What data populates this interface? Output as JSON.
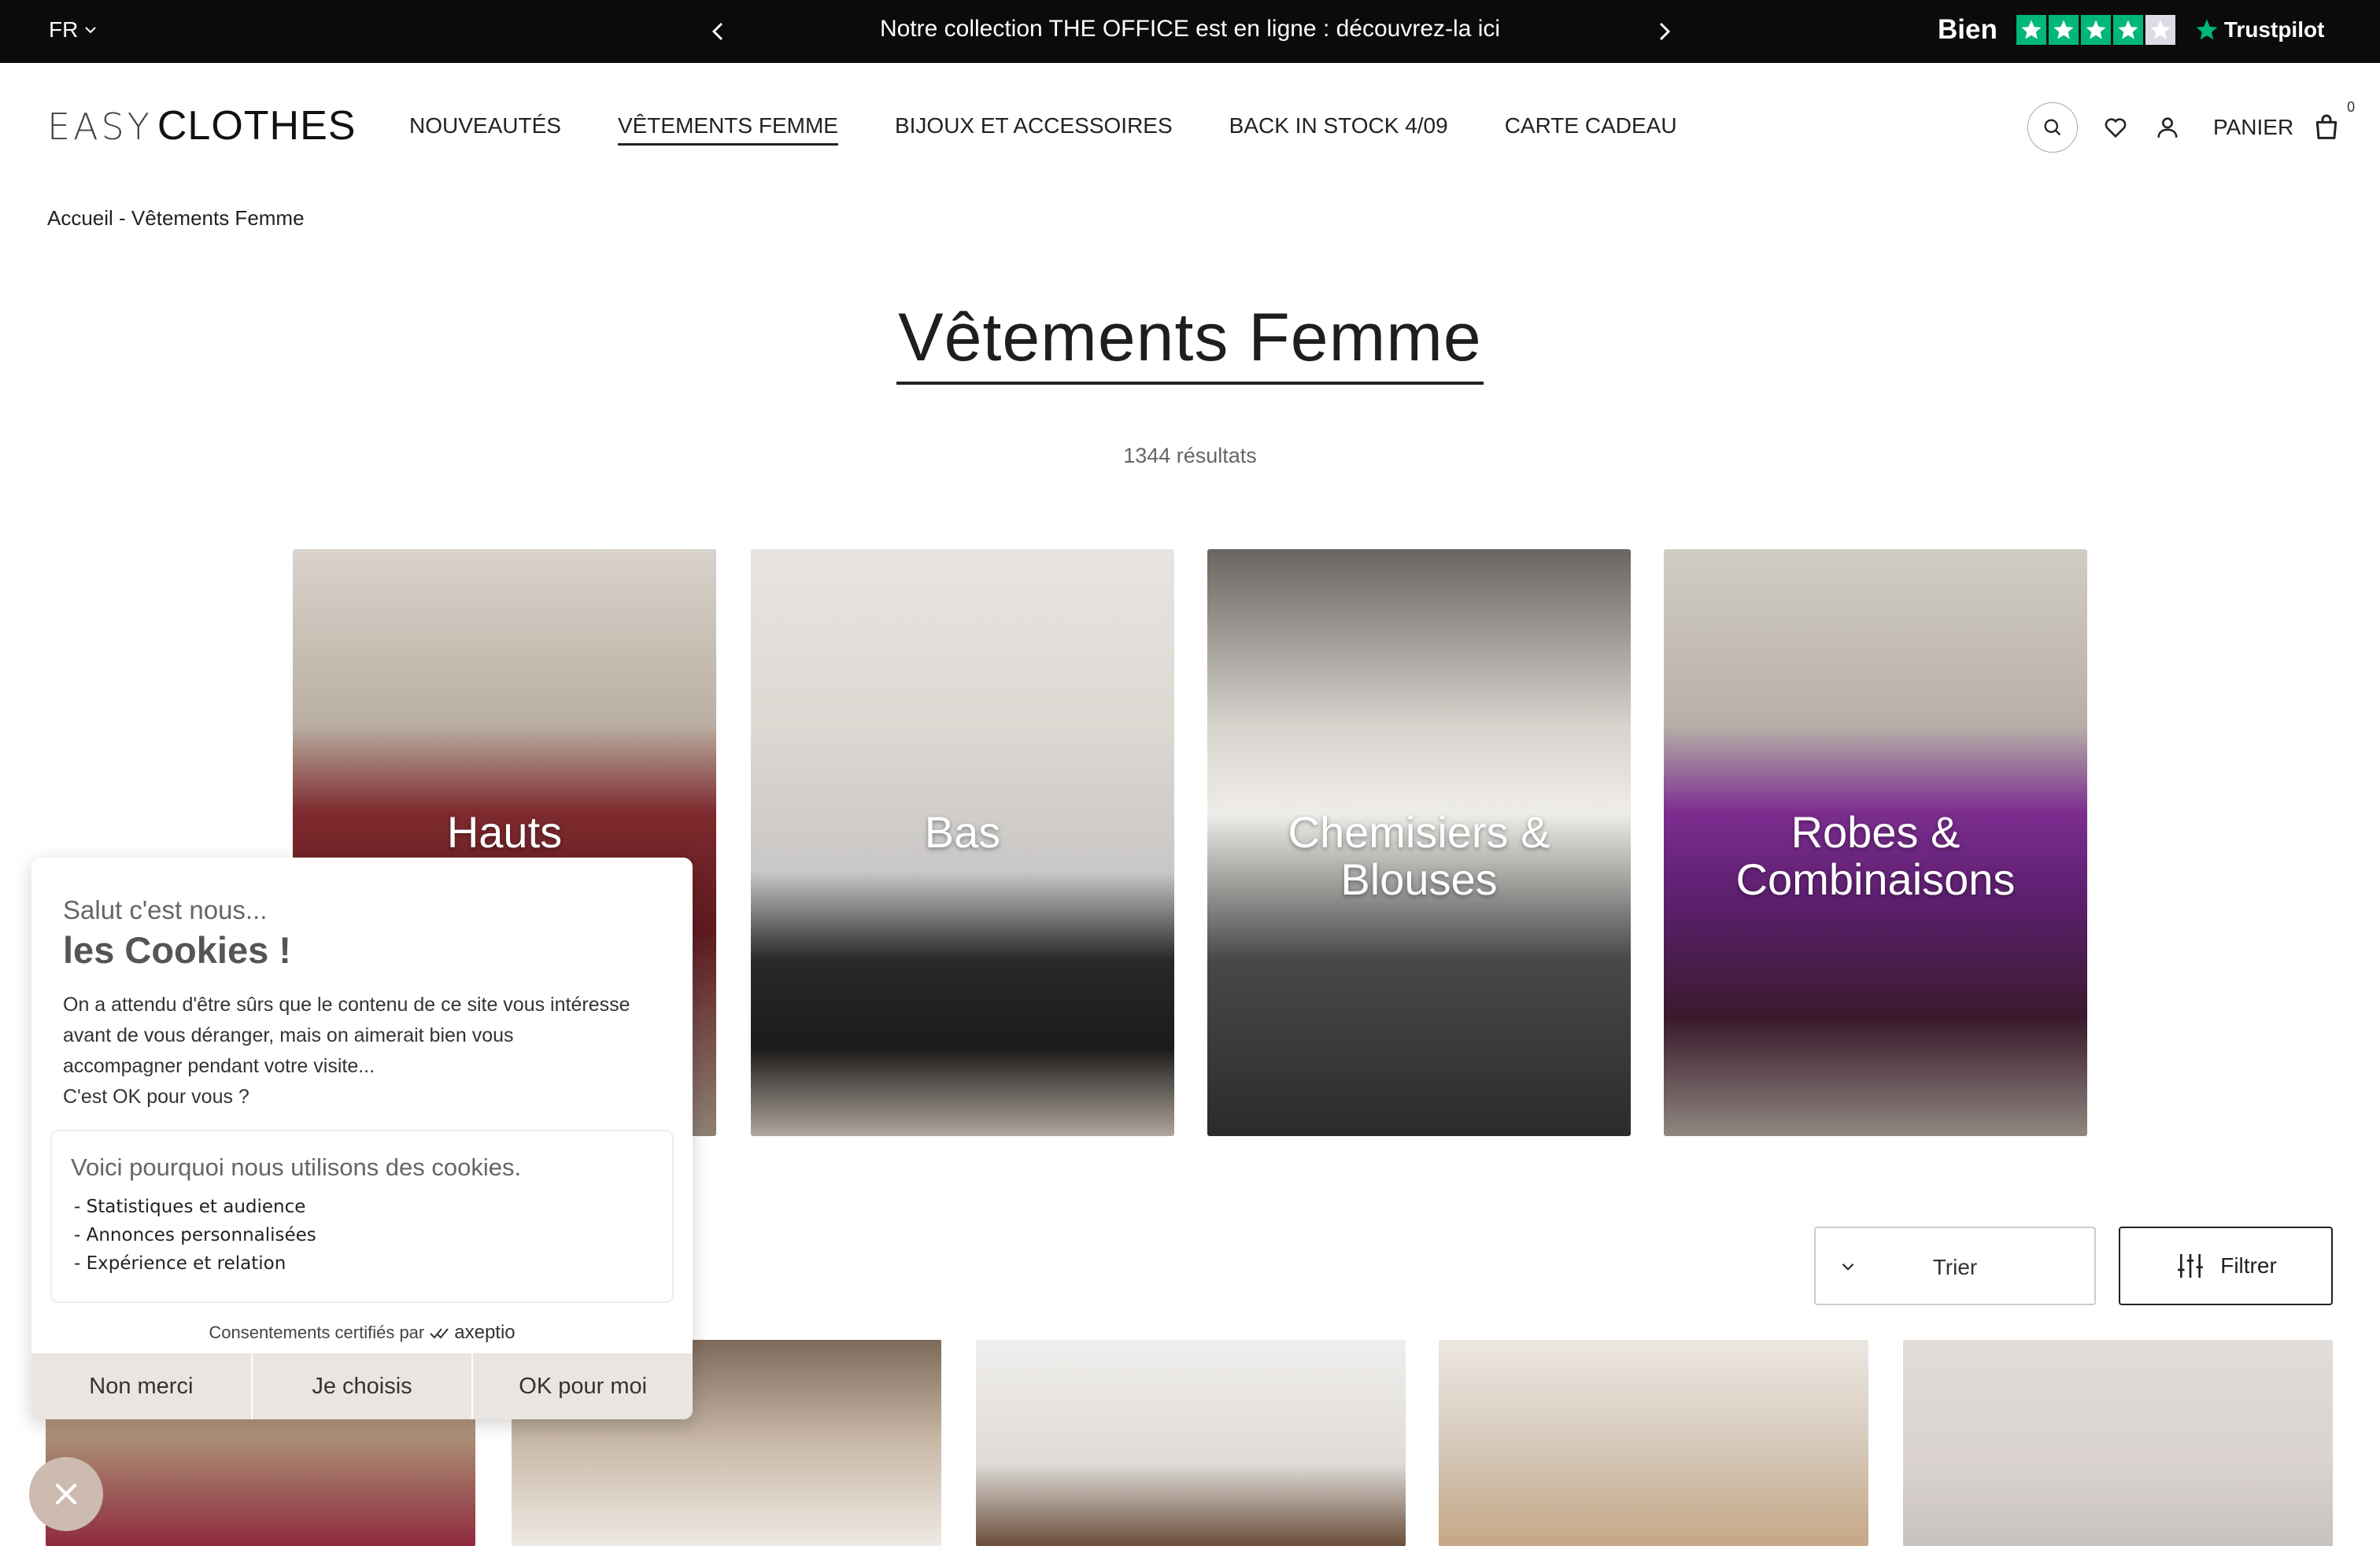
{
  "topbar": {
    "lang": "FR",
    "announcement": "Notre collection THE OFFICE est en ligne : découvrez-la ici",
    "trustpilot_rating": "Bien",
    "trustpilot_stars": 4,
    "trustpilot_brand": "Trustpilot"
  },
  "header": {
    "logo_easy": "EASY",
    "logo_clothes": "CLOTHES",
    "nav": [
      "NOUVEAUTÉS",
      "VÊTEMENTS FEMME",
      "BIJOUX ET ACCESSOIRES",
      "BACK IN STOCK 4/09",
      "CARTE CADEAU"
    ],
    "cart_label": "PANIER",
    "cart_count": "0"
  },
  "breadcrumb": "Accueil - Vêtements Femme",
  "page": {
    "title": "Vêtements Femme",
    "results": "1344 résultats"
  },
  "categories": [
    {
      "line1": "Hauts",
      "line2": ""
    },
    {
      "line1": "Bas",
      "line2": ""
    },
    {
      "line1": "Chemisiers &",
      "line2": "Blouses"
    },
    {
      "line1": "Robes &",
      "line2": "Combinaisons"
    }
  ],
  "toolbar": {
    "sort_label": "Trier",
    "filter_label": "Filtrer"
  },
  "cookie": {
    "hello": "Salut c'est nous...",
    "title": "les Cookies !",
    "body_1": "On a attendu d'être sûrs que le contenu de ce site vous intéresse",
    "body_2": "avant de vous déranger, mais on aimerait bien vous",
    "body_3": "accompagner pendant votre visite...",
    "body_4": "C'est OK pour vous ?",
    "box_title": "Voici pourquoi nous utilisons des cookies.",
    "reasons": [
      "- Statistiques et audience",
      "- Annonces personnalisées",
      "- Expérience et relation"
    ],
    "certified": "Consentements certifiés par",
    "certified_brand": "axeptio",
    "btn_no": "Non merci",
    "btn_choose": "Je choisis",
    "btn_ok": "OK pour moi"
  },
  "colors": {
    "topbar_bg": "#0b0b0b",
    "trustpilot_green": "#00b67a",
    "cookie_buttons_bg": "#ebe5e1",
    "close_bubble": "#cdbbb0"
  }
}
